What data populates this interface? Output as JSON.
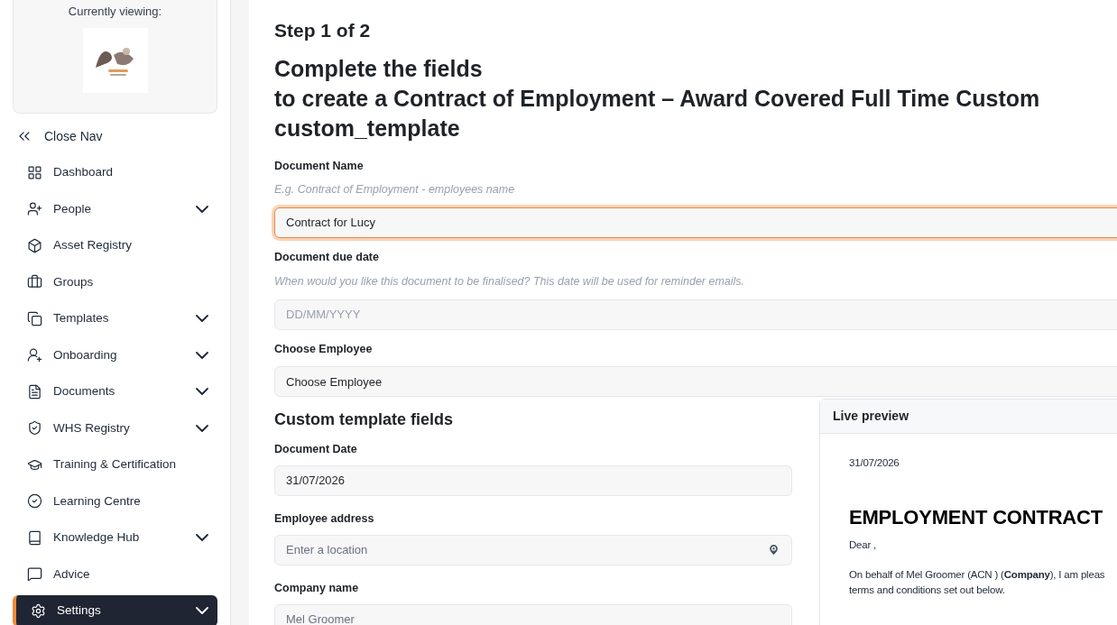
{
  "sidebar": {
    "viewing_label": "Currently viewing:",
    "close_nav": "Close Nav",
    "items": [
      {
        "label": "Dashboard",
        "expandable": false,
        "selected": false
      },
      {
        "label": "People",
        "expandable": true,
        "selected": false
      },
      {
        "label": "Asset Registry",
        "expandable": false,
        "selected": false
      },
      {
        "label": "Groups",
        "expandable": false,
        "selected": false
      },
      {
        "label": "Templates",
        "expandable": true,
        "selected": false
      },
      {
        "label": "Onboarding",
        "expandable": true,
        "selected": false
      },
      {
        "label": "Documents",
        "expandable": true,
        "selected": false
      },
      {
        "label": "WHS Registry",
        "expandable": true,
        "selected": false
      },
      {
        "label": "Training & Certification",
        "expandable": false,
        "selected": false
      },
      {
        "label": "Learning Centre",
        "expandable": false,
        "selected": false
      },
      {
        "label": "Knowledge Hub",
        "expandable": true,
        "selected": false
      },
      {
        "label": "Advice",
        "expandable": false,
        "selected": false
      },
      {
        "label": "Settings",
        "expandable": true,
        "selected": true
      }
    ]
  },
  "main": {
    "step": "Step 1 of 2",
    "title_lines": [
      "Complete the fields",
      "to create a Contract of Employment – Award Covered Full Time Custom",
      "custom_template"
    ],
    "fields": [
      {
        "label": "Document Name",
        "hint": "E.g. Contract of Employment - employees name",
        "value": "Contract for Lucy",
        "focused": true
      },
      {
        "label": "Document due date",
        "hint": "When would you like this document to be finalised? This date will be used for reminder emails.",
        "placeholder": "DD/MM/YYYY",
        "focused": false
      },
      {
        "label": "Choose Employee",
        "value": "Choose Employee",
        "focused": false
      }
    ],
    "custom_heading": "Custom template fields",
    "custom_fields": [
      {
        "label": "Document Date",
        "value": "31/07/2026",
        "kind": "text",
        "disabled": false
      },
      {
        "label": "Employee address",
        "placeholder": "Enter a location",
        "kind": "location",
        "disabled": false
      },
      {
        "label": "Company name",
        "value": "Mel Groomer",
        "kind": "text",
        "disabled": true
      }
    ],
    "preview": {
      "title": "Live preview",
      "date": "31/07/2026",
      "heading": "EMPLOYMENT CONTRACT",
      "paragraphs": [
        "Dear ,",
        "On behalf of Mel Groomer (ACN ) (**Company**), I am pleas",
        "terms and conditions set out below."
      ]
    }
  }
}
